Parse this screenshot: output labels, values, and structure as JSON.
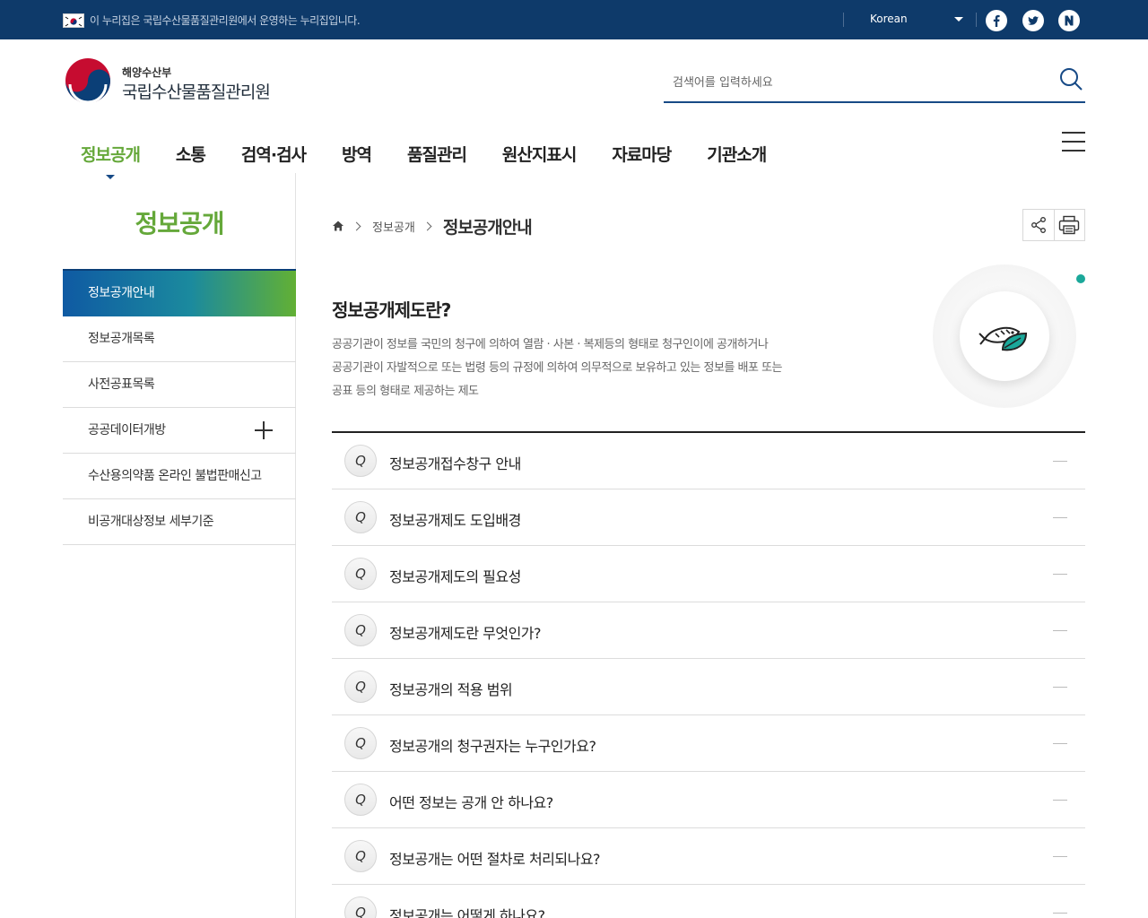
{
  "topbar": {
    "notice": "이 누리집은 국립수산물품질관리원에서 운영하는 누리집입니다.",
    "language": "Korean",
    "sns": [
      "facebook-icon",
      "twitter-icon",
      "naver-blog-icon"
    ]
  },
  "header": {
    "logo_sub": "해양수산부",
    "logo_main": "국립수산물품질관리원",
    "search_placeholder": "검색어를 입력하세요"
  },
  "gnb": {
    "items": [
      "정보공개",
      "소통",
      "검역·검사",
      "방역",
      "품질관리",
      "원산지표시",
      "자료마당",
      "기관소개"
    ],
    "active_index": 0
  },
  "lnb": {
    "title": "정보공개",
    "items": [
      "정보공개안내",
      "정보공개목록",
      "사전공표목록",
      "공공데이터개방",
      "수산용의약품 온라인 불법판매신고",
      "비공개대상정보 세부기준"
    ]
  },
  "breadcrumb": {
    "parent": "정보공개",
    "current": "정보공개안내"
  },
  "intro": {
    "title": "정보공개제도란?",
    "lines": [
      "공공기관이 정보를 국민의 청구에 의하여 열람 · 사본 · 복제등의 형태로 청구인이에 공개하거나",
      "공공기관이 자발적으로 또는 법령 등의 규정에 의하여 의무적으로 보유하고 있는 정보를 배포 또는",
      "공표 등의 형태로 제공하는 제도"
    ]
  },
  "faq": {
    "q_label": "Q",
    "items": [
      "정보공개접수창구 안내",
      "정보공개제도 도입배경",
      "정보공개제도의 필요성",
      "정보공개제도란 무엇인가?",
      "정보공개의 적용 범위",
      "정보공개의 청구권자는 누구인가요?",
      "어떤 정보는 공개 안 하나요?",
      "정보공개는 어떤 절차로 처리되나요?",
      "정보공개는 어떻게 하나요?"
    ]
  },
  "colors": {
    "topbar": "#0e3a6a",
    "accent_green": "#65a83a",
    "accent_blue": "#174a86",
    "teal_dot": "#1ba89a"
  }
}
